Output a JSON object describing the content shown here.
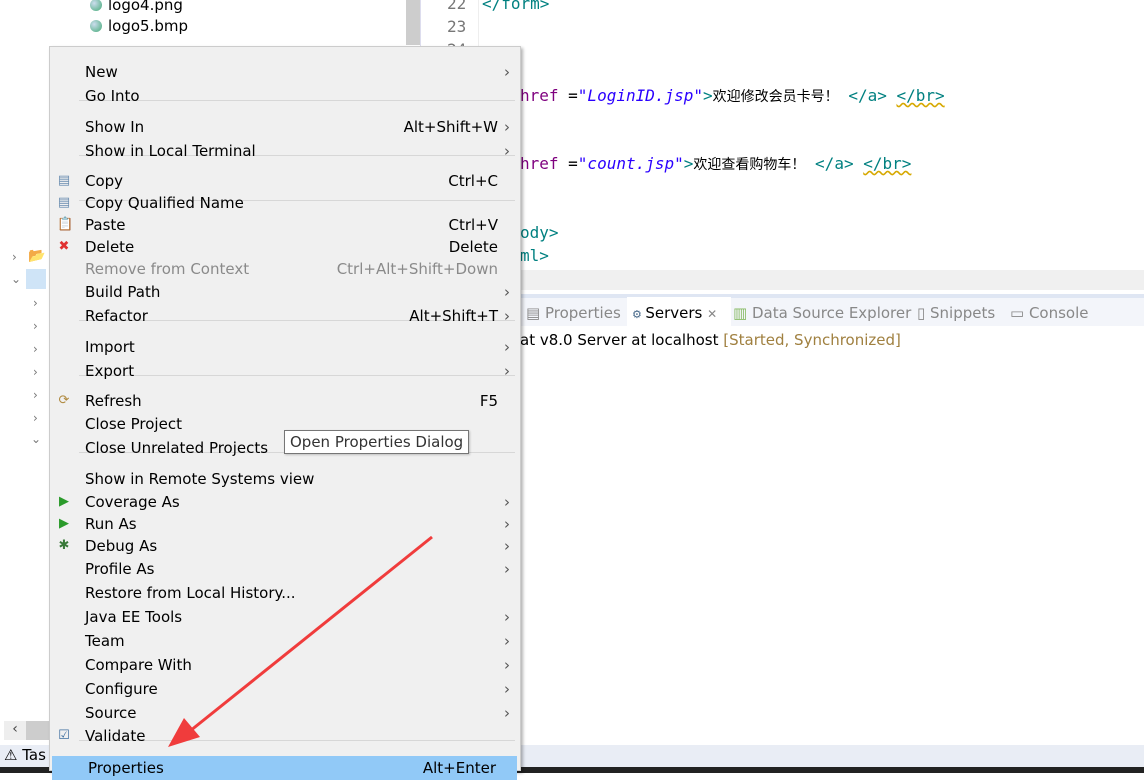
{
  "explorer": {
    "files": [
      "logo4.png",
      "logo5.bmp"
    ],
    "status_label": "Tas"
  },
  "editor": {
    "line_numbers": [
      "22",
      "23",
      "24"
    ],
    "line22": "</form>",
    "code_lines": [
      {
        "attr": "href",
        "eq": " =",
        "value": "\"LoginID.jsp\"",
        "gt": ">",
        "text": "欢迎修改会员卡号！",
        "close_a": "</a>",
        "br": "</br>"
      },
      {
        "attr": "href",
        "eq": " =",
        "value": "\"count.jsp\"",
        "gt": ">",
        "text": "欢迎查看购物车！",
        "close_a": "</a>",
        "br": "</br>"
      }
    ],
    "body_close": "ody>",
    "html_close": "ml>"
  },
  "bottom_panel": {
    "tabs": [
      {
        "label": "Properties"
      },
      {
        "label": "Servers",
        "active": true
      },
      {
        "label": "Data Source Explorer"
      },
      {
        "label": "Snippets"
      },
      {
        "label": "Console"
      }
    ],
    "server_name": "at v8.0 Server at localhost",
    "server_state": "[Started, Synchronized]"
  },
  "context_menu": {
    "items": [
      {
        "label": "New",
        "submenu": true
      },
      {
        "label": "Go Into"
      },
      {
        "label": "Show In",
        "shortcut": "Alt+Shift+W",
        "submenu": true
      },
      {
        "label": "Show in Local Terminal",
        "submenu": true
      },
      {
        "label": "Copy",
        "shortcut": "Ctrl+C",
        "icon": "copy-icon"
      },
      {
        "label": "Copy Qualified Name",
        "icon": "copy-qualified-icon"
      },
      {
        "label": "Paste",
        "shortcut": "Ctrl+V",
        "icon": "paste-icon"
      },
      {
        "label": "Delete",
        "shortcut": "Delete",
        "icon": "delete-icon"
      },
      {
        "label": "Remove from Context",
        "shortcut": "Ctrl+Alt+Shift+Down",
        "disabled": true
      },
      {
        "label": "Build Path",
        "submenu": true
      },
      {
        "label": "Refactor",
        "shortcut": "Alt+Shift+T",
        "submenu": true
      },
      {
        "label": "Import",
        "submenu": true
      },
      {
        "label": "Export",
        "submenu": true
      },
      {
        "label": "Refresh",
        "shortcut": "F5",
        "icon": "refresh-icon"
      },
      {
        "label": "Close Project"
      },
      {
        "label": "Close Unrelated Projects"
      },
      {
        "label": "Show in Remote Systems view"
      },
      {
        "label": "Coverage As",
        "submenu": true,
        "icon": "coverage-icon"
      },
      {
        "label": "Run As",
        "submenu": true,
        "icon": "run-icon"
      },
      {
        "label": "Debug As",
        "submenu": true,
        "icon": "debug-icon"
      },
      {
        "label": "Profile As",
        "submenu": true
      },
      {
        "label": "Restore from Local History..."
      },
      {
        "label": "Java EE Tools",
        "submenu": true
      },
      {
        "label": "Team",
        "submenu": true
      },
      {
        "label": "Compare With",
        "submenu": true
      },
      {
        "label": "Configure",
        "submenu": true
      },
      {
        "label": "Source",
        "submenu": true
      },
      {
        "label": "Validate",
        "icon": "checkbox-icon"
      },
      {
        "label": "Properties",
        "shortcut": "Alt+Enter",
        "selected": true
      }
    ]
  },
  "tooltip": "Open Properties Dialog",
  "annotation": {
    "color": "#f03c3c"
  }
}
